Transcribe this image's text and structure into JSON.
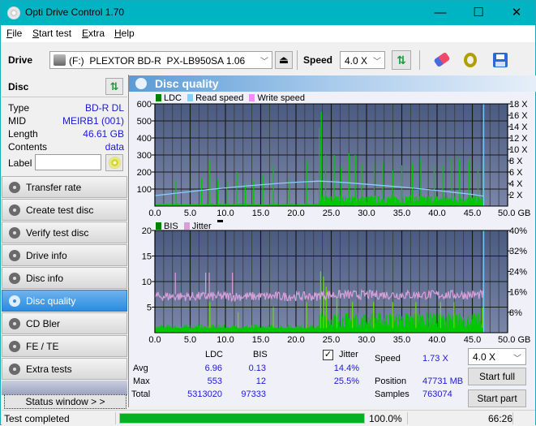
{
  "window": {
    "title": "Opti Drive Control 1.70",
    "minimize": "—",
    "maximize": "☐",
    "close": "✕"
  },
  "menu": [
    {
      "label": "File",
      "accel": "F",
      "rest": "ile"
    },
    {
      "label": "Start test",
      "accel": "S",
      "rest": "tart test"
    },
    {
      "label": "Extra",
      "accel": "E",
      "rest": "xtra"
    },
    {
      "label": "Help",
      "accel": "H",
      "rest": "elp"
    }
  ],
  "toolbar": {
    "drive_label": "Drive",
    "drive_value": "(F:)  PLEXTOR BD-R  PX-LB950SA 1.06",
    "speed_label": "Speed",
    "speed_value": "4.0 X",
    "icons": [
      "drive-icon",
      "eject-icon",
      "refresh-icon",
      "erase-icon",
      "settings-icon",
      "save-icon"
    ]
  },
  "disc": {
    "header": "Disc",
    "rows": [
      {
        "key": "Type",
        "value": "BD-R DL"
      },
      {
        "key": "MID",
        "value": "MEIRB1 (001)"
      },
      {
        "key": "Length",
        "value": "46.61 GB"
      },
      {
        "key": "Contents",
        "value": "data"
      }
    ],
    "label_key": "Label",
    "label_value": ""
  },
  "nav": [
    {
      "label": "Transfer rate",
      "active": false
    },
    {
      "label": "Create test disc",
      "active": false
    },
    {
      "label": "Verify test disc",
      "active": false
    },
    {
      "label": "Drive info",
      "active": false
    },
    {
      "label": "Disc info",
      "active": false
    },
    {
      "label": "Disc quality",
      "active": true
    },
    {
      "label": "CD Bler",
      "active": false
    },
    {
      "label": "FE / TE",
      "active": false
    },
    {
      "label": "Extra tests",
      "active": false
    }
  ],
  "status_window_button": "Status window > >",
  "panel_title": "Disc quality",
  "colors": {
    "ldc": "#00c800",
    "bis": "#00c800",
    "read_speed": "#87cefa",
    "write_speed": "#ff88ff",
    "jitter": "#d8a0d8",
    "plot_bg_top": "#4a5a80",
    "plot_bg_bottom": "#7a86a8",
    "accent": "#2a8ce0"
  },
  "chart_data": [
    {
      "type": "bar",
      "title": "LDC / Read speed",
      "legend": [
        "LDC",
        "Read speed",
        "Write speed"
      ],
      "legend_placement": "top-left",
      "xlabel": "GB",
      "x_ticks": [
        "0.0",
        "5.0",
        "10.0",
        "15.0",
        "20.0",
        "25.0",
        "30.0",
        "35.0",
        "40.0",
        "45.0",
        "50.0 GB"
      ],
      "xlim": [
        0,
        50
      ],
      "y_ticks": [
        "100",
        "200",
        "300",
        "400",
        "500",
        "600"
      ],
      "ylim": [
        0,
        600
      ],
      "y2_ticks": [
        "2 X",
        "4 X",
        "6 X",
        "8 X",
        "10 X",
        "12 X",
        "14 X",
        "16 X",
        "18 X"
      ],
      "y2lim": [
        0,
        18
      ],
      "grid": true,
      "end_marker_gb": 46.61,
      "ldc_peaks": [
        {
          "x": 3.0,
          "y": 150
        },
        {
          "x": 6.6,
          "y": 160
        },
        {
          "x": 7.7,
          "y": 265
        },
        {
          "x": 8.9,
          "y": 155
        },
        {
          "x": 10.2,
          "y": 150
        },
        {
          "x": 11.6,
          "y": 200
        },
        {
          "x": 12.8,
          "y": 130
        },
        {
          "x": 14.0,
          "y": 150
        },
        {
          "x": 15.3,
          "y": 180
        },
        {
          "x": 16.8,
          "y": 230
        },
        {
          "x": 19.1,
          "y": 155
        },
        {
          "x": 21.5,
          "y": 265
        },
        {
          "x": 23.3,
          "y": 460
        },
        {
          "x": 23.6,
          "y": 553
        },
        {
          "x": 24.2,
          "y": 300
        },
        {
          "x": 25.4,
          "y": 300
        },
        {
          "x": 26.4,
          "y": 230
        },
        {
          "x": 27.5,
          "y": 310
        },
        {
          "x": 28.4,
          "y": 300
        },
        {
          "x": 29.3,
          "y": 250
        },
        {
          "x": 31.1,
          "y": 255
        },
        {
          "x": 32.3,
          "y": 255
        },
        {
          "x": 33.7,
          "y": 210
        },
        {
          "x": 35.0,
          "y": 240
        },
        {
          "x": 36.5,
          "y": 250
        },
        {
          "x": 37.7,
          "y": 280
        },
        {
          "x": 39.6,
          "y": 240
        },
        {
          "x": 40.8,
          "y": 240
        },
        {
          "x": 42.1,
          "y": 290
        },
        {
          "x": 43.2,
          "y": 280
        },
        {
          "x": 44.5,
          "y": 270
        },
        {
          "x": 45.8,
          "y": 230
        },
        {
          "x": 46.5,
          "y": 230
        }
      ],
      "ldc_baseline_low": 10,
      "ldc_baseline_dense_from_gb": 23.3,
      "ldc_baseline_dense": 40,
      "read_speed": [
        {
          "x": 0,
          "y": 1.85
        },
        {
          "x": 2.5,
          "y": 2.2
        },
        {
          "x": 5,
          "y": 2.55
        },
        {
          "x": 7.5,
          "y": 2.9
        },
        {
          "x": 10,
          "y": 3.2
        },
        {
          "x": 12.5,
          "y": 3.5
        },
        {
          "x": 15,
          "y": 3.75
        },
        {
          "x": 17.5,
          "y": 4.0
        },
        {
          "x": 20,
          "y": 4.2
        },
        {
          "x": 22.5,
          "y": 4.35
        },
        {
          "x": 23.3,
          "y": 4.4
        },
        {
          "x": 25,
          "y": 4.3
        },
        {
          "x": 27.5,
          "y": 4.1
        },
        {
          "x": 30,
          "y": 3.85
        },
        {
          "x": 32.5,
          "y": 3.6
        },
        {
          "x": 35,
          "y": 3.35
        },
        {
          "x": 37.5,
          "y": 3.05
        },
        {
          "x": 40,
          "y": 2.75
        },
        {
          "x": 42.5,
          "y": 2.4
        },
        {
          "x": 45,
          "y": 2.05
        },
        {
          "x": 46.6,
          "y": 1.75
        }
      ]
    },
    {
      "type": "bar",
      "title": "BIS / Jitter",
      "legend": [
        "BIS",
        "Jitter"
      ],
      "legend_placement": "top-left",
      "xlabel": "GB",
      "x_ticks": [
        "0.0",
        "5.0",
        "10.0",
        "15.0",
        "20.0",
        "25.0",
        "30.0",
        "35.0",
        "40.0",
        "45.0",
        "50.0 GB"
      ],
      "xlim": [
        0,
        50
      ],
      "y_ticks": [
        "5",
        "10",
        "15",
        "20"
      ],
      "ylim": [
        0,
        20
      ],
      "y2_ticks": [
        "8%",
        "16%",
        "24%",
        "32%",
        "40%"
      ],
      "y2lim": [
        0,
        40
      ],
      "grid": true,
      "end_marker_gb": 46.61,
      "bis_peaks": [
        {
          "x": 7.8,
          "y": 6
        },
        {
          "x": 11.8,
          "y": 4
        },
        {
          "x": 16.8,
          "y": 5
        },
        {
          "x": 21.5,
          "y": 6
        },
        {
          "x": 23.5,
          "y": 12
        },
        {
          "x": 23.9,
          "y": 11
        },
        {
          "x": 24.3,
          "y": 9
        },
        {
          "x": 25.8,
          "y": 7
        },
        {
          "x": 28.0,
          "y": 6
        },
        {
          "x": 31.0,
          "y": 6
        },
        {
          "x": 33.7,
          "y": 6
        },
        {
          "x": 37.0,
          "y": 6
        },
        {
          "x": 40.5,
          "y": 6
        },
        {
          "x": 42.4,
          "y": 6
        },
        {
          "x": 46.4,
          "y": 5
        }
      ],
      "bis_baseline_low": 1,
      "bis_baseline_dense_from_gb": 23.3,
      "bis_baseline_dense": 2.5,
      "jitter_mean_pct": 14.4,
      "jitter_range_pct": [
        12.5,
        17
      ],
      "jitter_spikes": [
        {
          "x": 2.9,
          "y": 23.5
        },
        {
          "x": 7.2,
          "y": 23.5
        },
        {
          "x": 7.7,
          "y": 23.5
        },
        {
          "x": 11.0,
          "y": 23.5
        }
      ],
      "jitter_step_at_gb": 23.3
    }
  ],
  "stats": {
    "col_ldc": "LDC",
    "col_bis": "BIS",
    "jitter_label": "Jitter",
    "jitter_checked": true,
    "rows": [
      {
        "label": "Avg",
        "ldc": "6.96",
        "bis": "0.13",
        "jitter": "14.4%"
      },
      {
        "label": "Max",
        "ldc": "553",
        "bis": "12",
        "jitter": "25.5%"
      },
      {
        "label": "Total",
        "ldc": "5313020",
        "bis": "97333",
        "jitter": ""
      }
    ],
    "speed_label": "Speed",
    "speed_value": "1.73 X",
    "position_label": "Position",
    "position_value": "47731 MB",
    "samples_label": "Samples",
    "samples_value": "763074",
    "speed_select": "4.0 X",
    "start_full": "Start full",
    "start_part": "Start part"
  },
  "statusbar": {
    "text": "Test completed",
    "progress": 100.0,
    "progress_text": "100.0%",
    "time": "66:26"
  }
}
